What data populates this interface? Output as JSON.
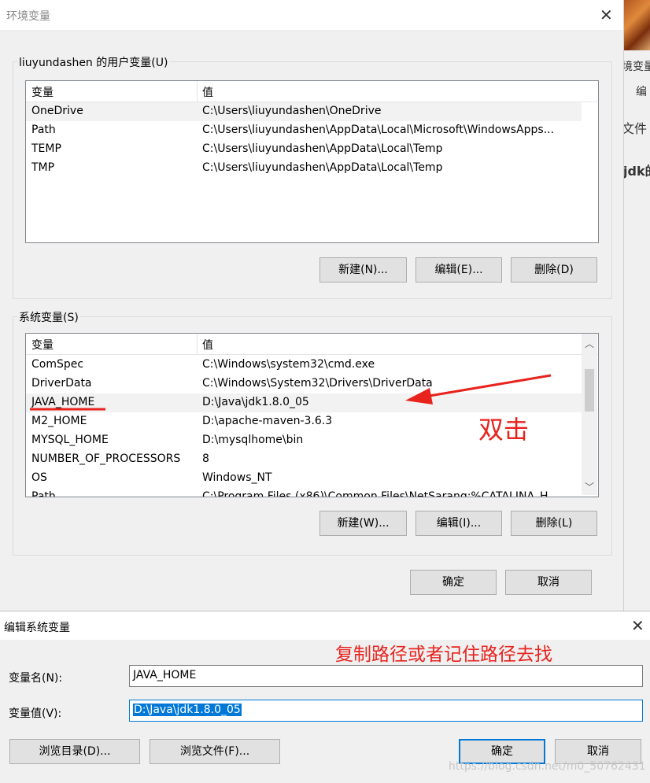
{
  "background_app": {
    "partial_texts": [
      "境变量",
      "编",
      "文件",
      "jdk的"
    ]
  },
  "main_dialog": {
    "title": "环境变量",
    "user_group_label": "liuyundashen 的用户变量(U)",
    "user_headers": [
      "变量",
      "值"
    ],
    "user_rows": [
      {
        "name": "OneDrive",
        "value": "C:\\Users\\liuyundashen\\OneDrive"
      },
      {
        "name": "Path",
        "value": "C:\\Users\\liuyundashen\\AppData\\Local\\Microsoft\\WindowsApps..."
      },
      {
        "name": "TEMP",
        "value": "C:\\Users\\liuyundashen\\AppData\\Local\\Temp"
      },
      {
        "name": "TMP",
        "value": "C:\\Users\\liuyundashen\\AppData\\Local\\Temp"
      }
    ],
    "user_buttons": {
      "new": "新建(N)...",
      "edit": "编辑(E)...",
      "delete": "删除(D)"
    },
    "system_group_label": "系统变量(S)",
    "system_headers": [
      "变量",
      "值"
    ],
    "system_rows": [
      {
        "name": "ComSpec",
        "value": "C:\\Windows\\system32\\cmd.exe"
      },
      {
        "name": "DriverData",
        "value": "C:\\Windows\\System32\\Drivers\\DriverData"
      },
      {
        "name": "JAVA_HOME",
        "value": "D:\\Java\\jdk1.8.0_05"
      },
      {
        "name": "M2_HOME",
        "value": "D:\\apache-maven-3.6.3"
      },
      {
        "name": "MYSQL_HOME",
        "value": "D:\\mysqlhome\\bin"
      },
      {
        "name": "NUMBER_OF_PROCESSORS",
        "value": "8"
      },
      {
        "name": "OS",
        "value": "Windows_NT"
      },
      {
        "name": "Path",
        "value": "C:\\Program Files (x86)\\Common Files\\NetSarang;%CATALINA_H"
      }
    ],
    "system_buttons": {
      "new": "新建(W)...",
      "edit": "编辑(I)...",
      "delete": "删除(L)"
    },
    "ok": "确定",
    "cancel": "取消"
  },
  "edit_dialog": {
    "title": "编辑系统变量",
    "name_label": "变量名(N):",
    "name_value": "JAVA_HOME",
    "value_label": "变量值(V):",
    "value_value": "D:\\Java\\jdk1.8.0_05",
    "browse_dir": "浏览目录(D)...",
    "browse_file": "浏览文件(F)...",
    "ok": "确定",
    "cancel": "取消"
  },
  "annotations": {
    "double_click": "双击",
    "copy_path": "复制路径或者记住路径去找"
  },
  "watermark": "https://blog.csdn.net/m0_50762431",
  "colors": {
    "annotation": "#e8231e",
    "accent": "#0078d7"
  }
}
